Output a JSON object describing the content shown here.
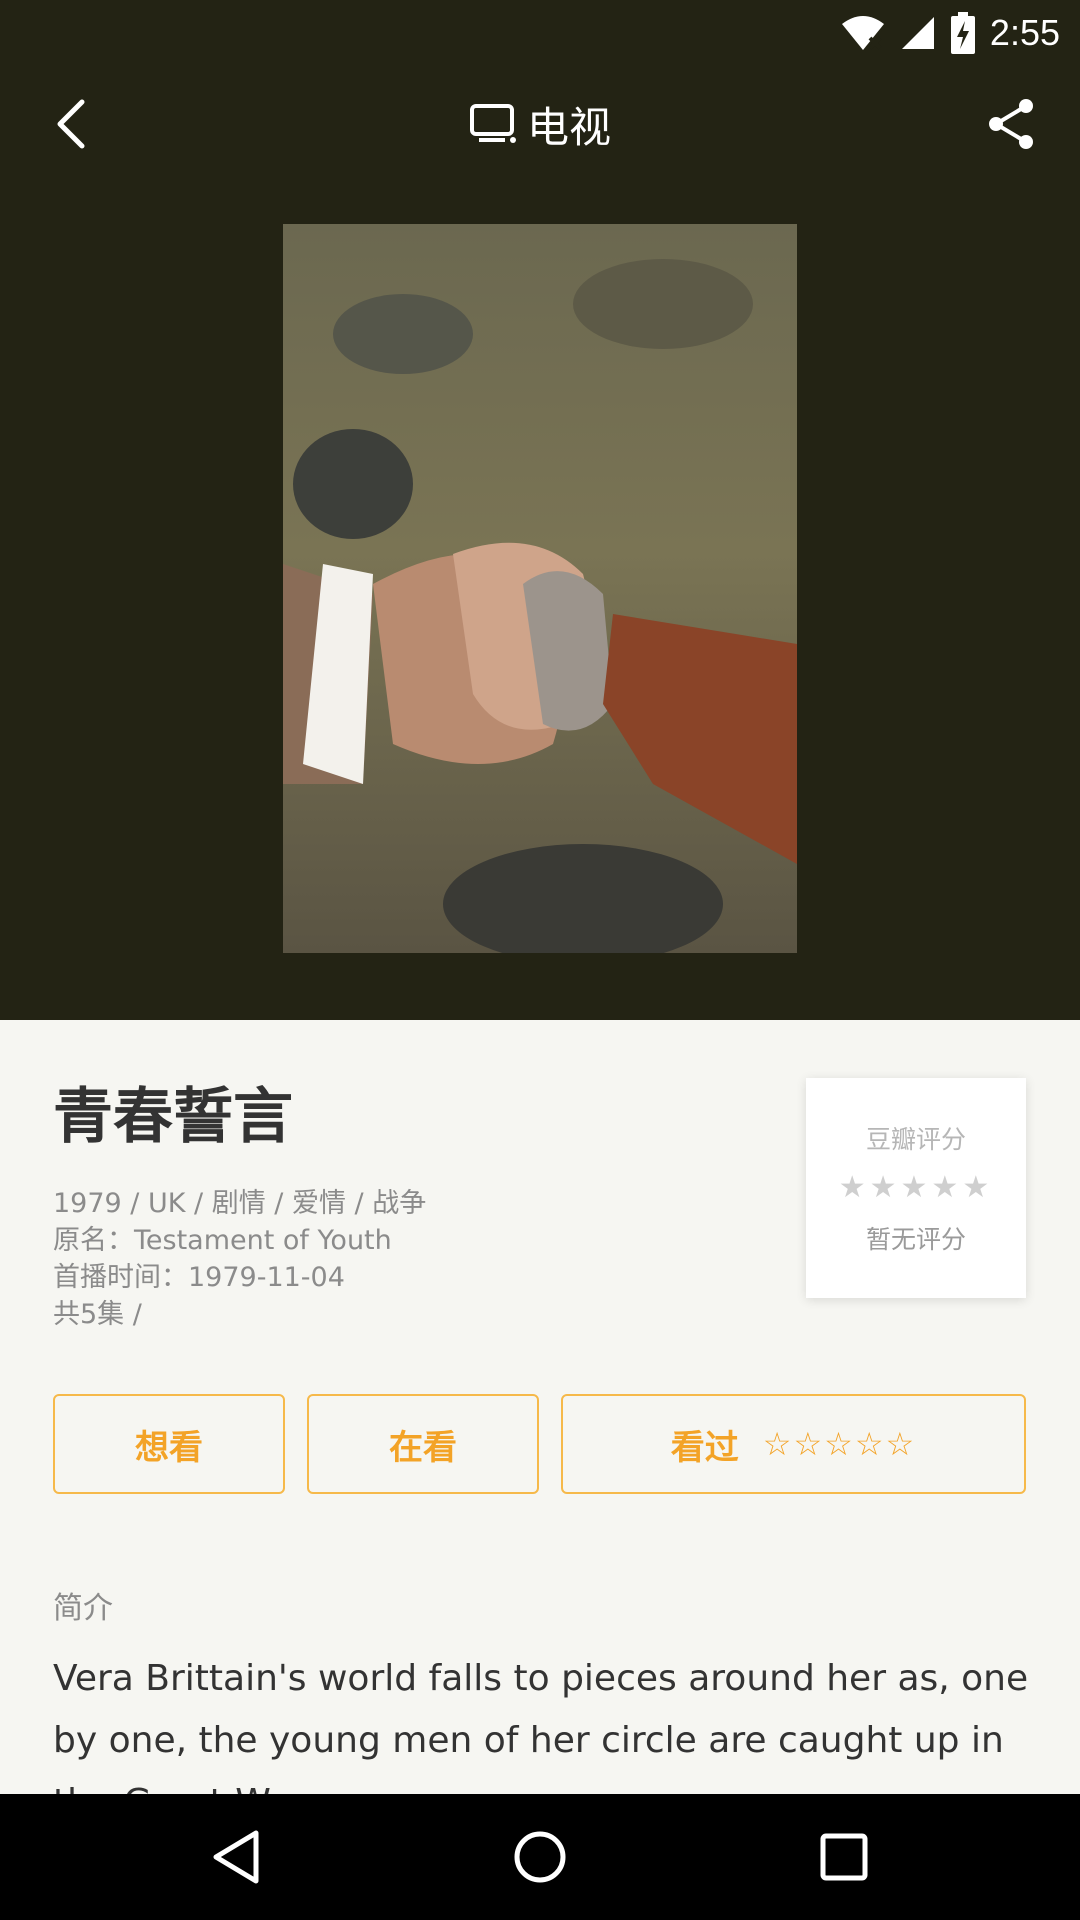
{
  "status": {
    "time": "2:55"
  },
  "toolbar": {
    "title": "电视"
  },
  "movie": {
    "title": "青春誓言",
    "meta_line1": "1979 / UK / 剧情 / 爱情 / 战争",
    "original_name": "原名：Testament of Youth",
    "premiere": "首播时间：1979-11-04",
    "episodes": "共5集 /"
  },
  "rating": {
    "label": "豆瓣评分",
    "stars": "★★★★★",
    "value": "暂无评分"
  },
  "actions": {
    "want": "想看",
    "watching": "在看",
    "watched": "看过",
    "watched_stars": "☆☆☆☆☆"
  },
  "intro": {
    "label": "简介",
    "text": "Vera Brittain's world falls to pieces around her as, one by one, the young men of her circle are caught up in the Great W..."
  },
  "colors": {
    "accent": "#f3a327",
    "hero_bg": "#232314",
    "page_bg": "#f6f6f2"
  }
}
